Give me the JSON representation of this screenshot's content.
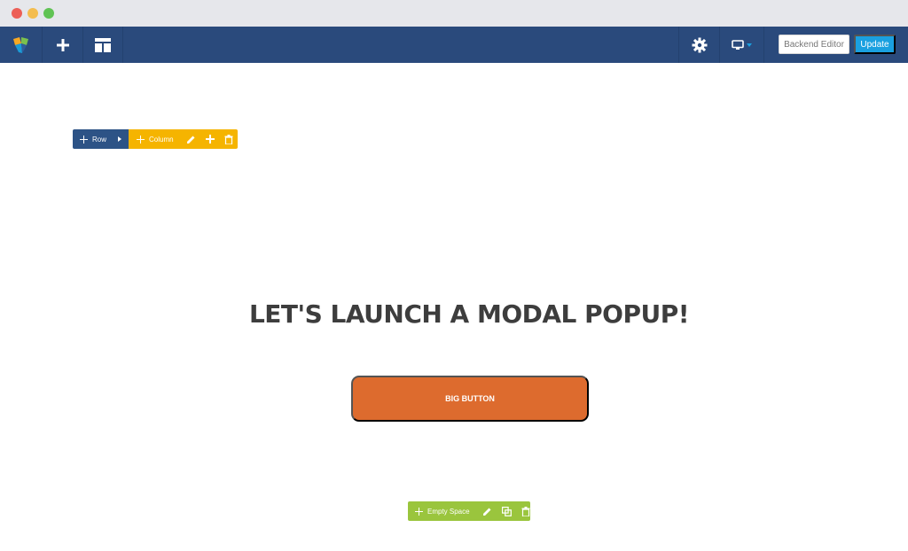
{
  "toolbar": {
    "backend_editor_label": "Backend Editor",
    "update_label": "Update",
    "icons": [
      "brand-logo-icon",
      "plus-icon",
      "layout-icon",
      "gear-icon",
      "monitor-icon",
      "caret-down-icon"
    ]
  },
  "row_control": {
    "label": "Row"
  },
  "column_control": {
    "label": "Column"
  },
  "content": {
    "heading": "LET'S LAUNCH A MODAL POPUP!",
    "button_label": "BIG BUTTON"
  },
  "empty_space_control": {
    "label": "Empty Space"
  },
  "colors": {
    "toolbar": "#2a4a7c",
    "row": "#2d5386",
    "column": "#f5b400",
    "empty_space": "#9ac53d",
    "button": "#dd6b2e",
    "update": "#1aa0e0"
  }
}
